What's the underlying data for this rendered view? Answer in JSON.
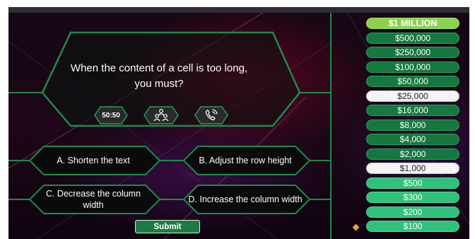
{
  "question": {
    "line1": "When the content of a cell is too long,",
    "line2": "you must?"
  },
  "lifelines": {
    "fifty_fifty": "50:50",
    "audience_icon": "audience-people-icon",
    "phone_icon": "phone-call-icon"
  },
  "answers": {
    "a": "A. Shorten the text",
    "b": "B. Adjust the row height",
    "c_line1": "C. Decrease the column",
    "c_line2": "width",
    "d": "D. Increase the column width"
  },
  "submit_label": "Submit",
  "ladder": [
    "$1 MILLION",
    "$500,000",
    "$250,000",
    "$100,000",
    "$50,000",
    "$25,000",
    "$16,000",
    "$8,000",
    "$4,000",
    "$2,000",
    "$1,000",
    "$500",
    "$300",
    "$200",
    "$100"
  ],
  "current_level": "$100",
  "colors": {
    "accent_green": "#1f7a45",
    "top_prize": "#8bd24e",
    "low_levels": "#2fc27a",
    "safe_haven": "#f4f4f4",
    "marker": "#f0a030"
  }
}
